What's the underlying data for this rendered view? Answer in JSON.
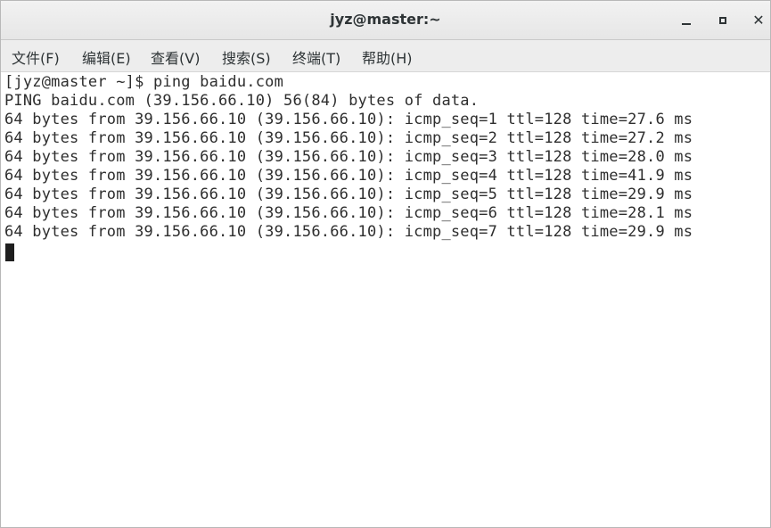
{
  "window": {
    "title": "jyz@master:~"
  },
  "menu": {
    "items": [
      {
        "label": "文件(F)"
      },
      {
        "label": "编辑(E)"
      },
      {
        "label": "查看(V)"
      },
      {
        "label": "搜索(S)"
      },
      {
        "label": "终端(T)"
      },
      {
        "label": "帮助(H)"
      }
    ]
  },
  "terminal": {
    "lines": [
      "[jyz@master ~]$ ping baidu.com",
      "PING baidu.com (39.156.66.10) 56(84) bytes of data.",
      "64 bytes from 39.156.66.10 (39.156.66.10): icmp_seq=1 ttl=128 time=27.6 ms",
      "64 bytes from 39.156.66.10 (39.156.66.10): icmp_seq=2 ttl=128 time=27.2 ms",
      "64 bytes from 39.156.66.10 (39.156.66.10): icmp_seq=3 ttl=128 time=28.0 ms",
      "64 bytes from 39.156.66.10 (39.156.66.10): icmp_seq=4 ttl=128 time=41.9 ms",
      "64 bytes from 39.156.66.10 (39.156.66.10): icmp_seq=5 ttl=128 time=29.9 ms",
      "64 bytes from 39.156.66.10 (39.156.66.10): icmp_seq=6 ttl=128 time=28.1 ms",
      "64 bytes from 39.156.66.10 (39.156.66.10): icmp_seq=7 ttl=128 time=29.9 ms"
    ]
  },
  "controls": {
    "minimize_icon": "minimize-icon",
    "maximize_icon": "maximize-icon",
    "close_icon": "close-icon",
    "close_glyph": "✕"
  }
}
